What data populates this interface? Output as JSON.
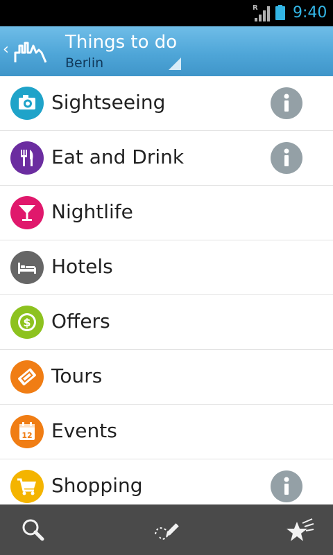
{
  "status_bar": {
    "time": "9:40",
    "signal_roaming": "R"
  },
  "header": {
    "title": "Things to do",
    "subtitle": "Berlin"
  },
  "categories": [
    {
      "label": "Sightseeing",
      "icon": "camera-icon",
      "color": "#1fa3c9",
      "has_info": true
    },
    {
      "label": "Eat and Drink",
      "icon": "fork-knife-icon",
      "color": "#6b2da0",
      "has_info": true
    },
    {
      "label": "Nightlife",
      "icon": "cocktail-icon",
      "color": "#e0186c",
      "has_info": false
    },
    {
      "label": "Hotels",
      "icon": "bed-icon",
      "color": "#666666",
      "has_info": false
    },
    {
      "label": "Offers",
      "icon": "dollar-badge-icon",
      "color": "#8dc21f",
      "has_info": false
    },
    {
      "label": "Tours",
      "icon": "ticket-icon",
      "color": "#f07d14",
      "has_info": false
    },
    {
      "label": "Events",
      "icon": "calendar-icon",
      "color": "#f07d14",
      "calendar_day": "12",
      "has_info": false
    },
    {
      "label": "Shopping",
      "icon": "shopping-cart-icon",
      "color": "#f4b400",
      "has_info": true
    }
  ],
  "toolbar": {
    "items": [
      "search-icon",
      "draw-route-icon",
      "favorites-icon"
    ]
  },
  "colors": {
    "header_blue": "#4fa6d8",
    "info_gray": "#94a0a6",
    "bottom_bar": "#4a4a4a",
    "status_time": "#33b5e5"
  }
}
